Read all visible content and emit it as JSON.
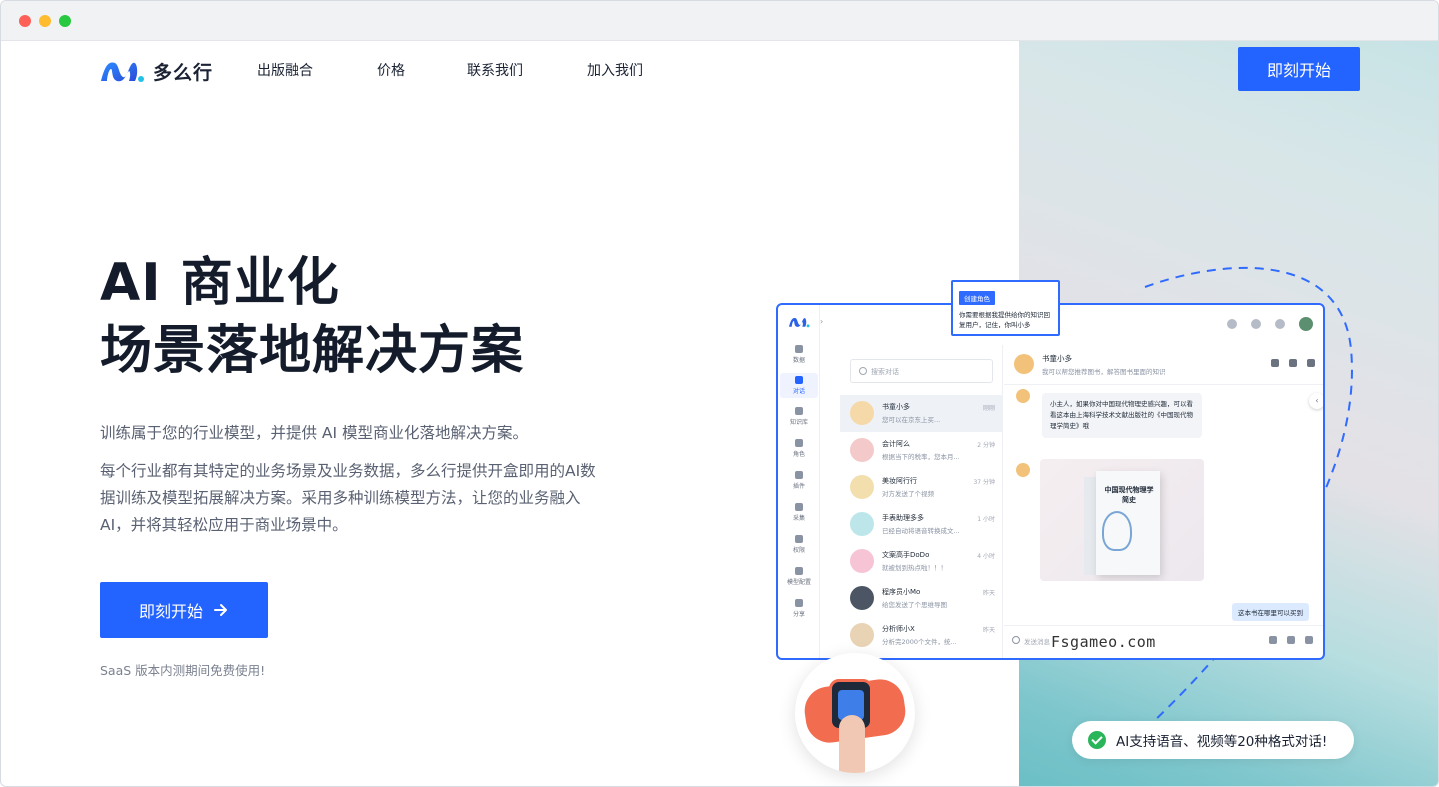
{
  "brand": {
    "name": "多么行",
    "color": "#2363ff"
  },
  "nav": {
    "items": [
      "出版融合",
      "价格",
      "联系我们",
      "加入我们"
    ],
    "cta": "即刻开始"
  },
  "hero": {
    "title_line1": "AI 商业化",
    "title_line2": "场景落地解决方案",
    "subtitle": "训练属于您的行业模型，并提供 AI 模型商业化落地解决方案。",
    "description": "每个行业都有其特定的业务场景及业务数据，多么行提供开盒即用的AI数据训练及模型拓展解决方案。采用多种训练模型方法，让您的业务融入AI，并将其轻松应用于商业场景中。",
    "cta": "即刻开始",
    "note": "SaaS 版本内测期间免费使用!"
  },
  "tooltip": {
    "tag": "创建角色",
    "text": "你需要根据我提供给你的知识回复用户，记住，你叫小多"
  },
  "app": {
    "sidebar": [
      "数据",
      "对话",
      "知识库",
      "角色",
      "插件",
      "采集",
      "权限",
      "模型配置",
      "分享"
    ],
    "search_placeholder": "搜索对话",
    "conversations": [
      {
        "name": "书童小多",
        "msg": "您可以在京东上买...",
        "time": "刚刚"
      },
      {
        "name": "会计阿么",
        "msg": "根据当下的税率，您本月...",
        "time": "2 分钟"
      },
      {
        "name": "美妆阿行行",
        "msg": "对方发送了个视频",
        "time": "37 分钟"
      },
      {
        "name": "手表助理多多",
        "msg": "已经自动将语音转换成文...",
        "time": "1 小时"
      },
      {
        "name": "文案高手DoDo",
        "msg": "就被划到热点啦！！！",
        "time": "4 小时"
      },
      {
        "name": "程序员小Mo",
        "msg": "给您发送了个思维导图",
        "time": "昨天"
      },
      {
        "name": "分析师小X",
        "msg": "分析完2000个文件，统...",
        "time": "昨天"
      }
    ],
    "chat": {
      "name": "书童小多",
      "sub": "我可以帮您推荐图书，解答图书里面的知识",
      "bubble": "小主人，如果你对中国现代物理史感兴趣，可以看看这本由上海科学技术文献出版社的《中国现代物理学简史》哦",
      "book_title": "中国现代物理学简史",
      "reply": "这本书在哪里可以买到",
      "input_placeholder": "发送消息"
    }
  },
  "watermark": "Fsgameo.com",
  "feature_pill": "AI支持语音、视频等20种格式对话!"
}
